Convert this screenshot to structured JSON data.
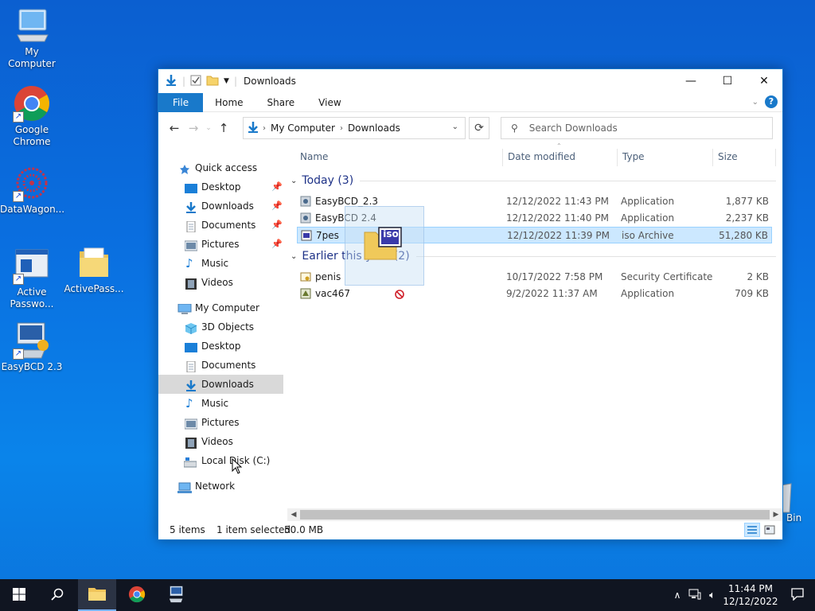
{
  "desktop": {
    "icons": [
      {
        "label": "My Computer"
      },
      {
        "label": "Google Chrome"
      },
      {
        "label": "DataWagon..."
      },
      {
        "label": "Active Passwo..."
      },
      {
        "label": "ActivePass..."
      },
      {
        "label": "EasyBCD 2.3"
      },
      {
        "label": "Bin"
      }
    ]
  },
  "window": {
    "title": "Downloads",
    "controls": {
      "minimize": "—",
      "maximize": "☐",
      "close": "✕"
    },
    "ribbon": {
      "tabs": [
        "File",
        "Home",
        "Share",
        "View"
      ]
    },
    "address": {
      "crumbs": [
        "My Computer",
        "Downloads"
      ]
    },
    "search": {
      "placeholder": "Search Downloads"
    },
    "navpane": {
      "items": [
        {
          "label": "Quick access"
        },
        {
          "label": "Desktop"
        },
        {
          "label": "Downloads"
        },
        {
          "label": "Documents"
        },
        {
          "label": "Pictures"
        },
        {
          "label": "Music"
        },
        {
          "label": "Videos"
        },
        {
          "label": "My Computer"
        },
        {
          "label": "3D Objects"
        },
        {
          "label": "Desktop"
        },
        {
          "label": "Documents"
        },
        {
          "label": "Downloads"
        },
        {
          "label": "Music"
        },
        {
          "label": "Pictures"
        },
        {
          "label": "Videos"
        },
        {
          "label": "Local Disk (C:)"
        },
        {
          "label": "Network"
        }
      ]
    },
    "columns": [
      "Name",
      "Date modified",
      "Type",
      "Size"
    ],
    "groups": [
      {
        "label": "Today (3)"
      },
      {
        "label": "Earlier this year (2)"
      }
    ],
    "files": [
      {
        "name": "EasyBCD_2.3",
        "date": "12/12/2022 11:43 PM",
        "type": "Application",
        "size": "1,877 KB"
      },
      {
        "name": "EasyBCD 2.4",
        "date": "12/12/2022 11:40 PM",
        "type": "Application",
        "size": "2,237 KB"
      },
      {
        "name": "7pes",
        "date": "12/12/2022 11:39 PM",
        "type": "iso Archive",
        "size": "51,280 KB"
      },
      {
        "name": "penis",
        "date": "10/17/2022 7:58 PM",
        "type": "Security Certificate",
        "size": "2 KB"
      },
      {
        "name": "vac467",
        "date": "9/2/2022 11:37 AM",
        "type": "Application",
        "size": "709 KB"
      }
    ],
    "status": {
      "count": "5 items",
      "selected": "1 item selected",
      "size": "50.0 MB"
    },
    "drag_badge": "iso"
  },
  "taskbar": {
    "time": "11:44 PM",
    "date": "12/12/2022"
  },
  "colors": {
    "accent": "#1979ca",
    "selection": "#cce8ff",
    "taskbar": "#101521"
  }
}
